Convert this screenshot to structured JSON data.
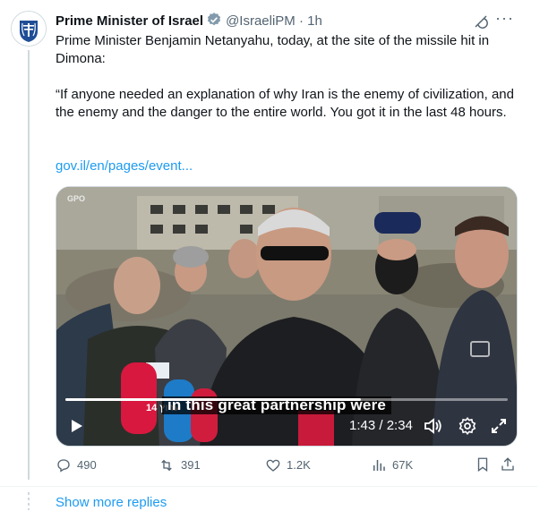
{
  "tweet": {
    "author_name": "Prime Minister of Israel",
    "handle": "@IsraeliPM",
    "separator": "·",
    "time": "1h",
    "text": "Prime Minister Benjamin Netanyahu, today, at the site of the missile hit in Dimona:\n\n“If anyone needed an explanation of why Iran is the enemy of civilization, and the enemy and the danger to the entire world. You got it in the last 48 hours.",
    "link": "gov.il/en/pages/event...",
    "icons": [
      "verified-badge-icon",
      "grok-icon",
      "more-icon"
    ]
  },
  "video": {
    "caption": "in this great partnership were",
    "watermark": "GPO",
    "mic_label": "ערוץ 14",
    "time_display": "1:43 / 2:34",
    "progress": 0.669,
    "icons": [
      "play-icon",
      "volume-icon",
      "settings-icon",
      "fullscreen-icon",
      "picture-in-picture-icon"
    ]
  },
  "actions": {
    "replies": "490",
    "reposts": "391",
    "likes": "1.2K",
    "views": "67K",
    "icons": [
      "reply-icon",
      "repost-icon",
      "like-icon",
      "views-icon",
      "bookmark-icon",
      "share-icon"
    ]
  },
  "show_more": "Show more replies",
  "colors": {
    "accent": "#1d9bf0",
    "secondary_text": "#536471",
    "verified_gray": "#829aab"
  }
}
